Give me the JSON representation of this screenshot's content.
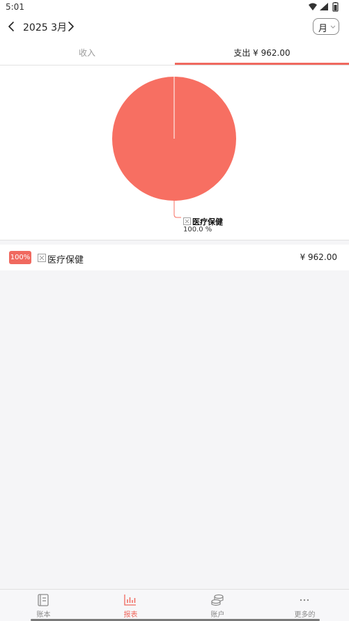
{
  "status_bar": {
    "time": "5:01",
    "icons": [
      "wifi-icon",
      "signal-icon",
      "battery-icon"
    ]
  },
  "header": {
    "month": "2025 3月",
    "period": "月"
  },
  "tabs": {
    "income_label": "收入",
    "expense_label": "支出  ¥ 962.00",
    "active": "expense",
    "accent_color": "#f0695f"
  },
  "chart_data": {
    "type": "pie",
    "slices": [
      {
        "label": "医疗保健",
        "value": 100.0,
        "percent_label": "100.0 %",
        "color": "#f76f62"
      }
    ]
  },
  "list": {
    "items": [
      {
        "percent": "100%",
        "category": "医疗保健",
        "icon": "medical-icon",
        "amount": "¥ 962.00"
      }
    ]
  },
  "bottom_nav": {
    "items": [
      {
        "label": "账本",
        "icon": "ledger-icon",
        "active": false
      },
      {
        "label": "报表",
        "icon": "report-chart-icon",
        "active": true
      },
      {
        "label": "账户",
        "icon": "account-coins-icon",
        "active": false
      },
      {
        "label": "更多的",
        "icon": "more-icon",
        "active": false
      }
    ]
  }
}
